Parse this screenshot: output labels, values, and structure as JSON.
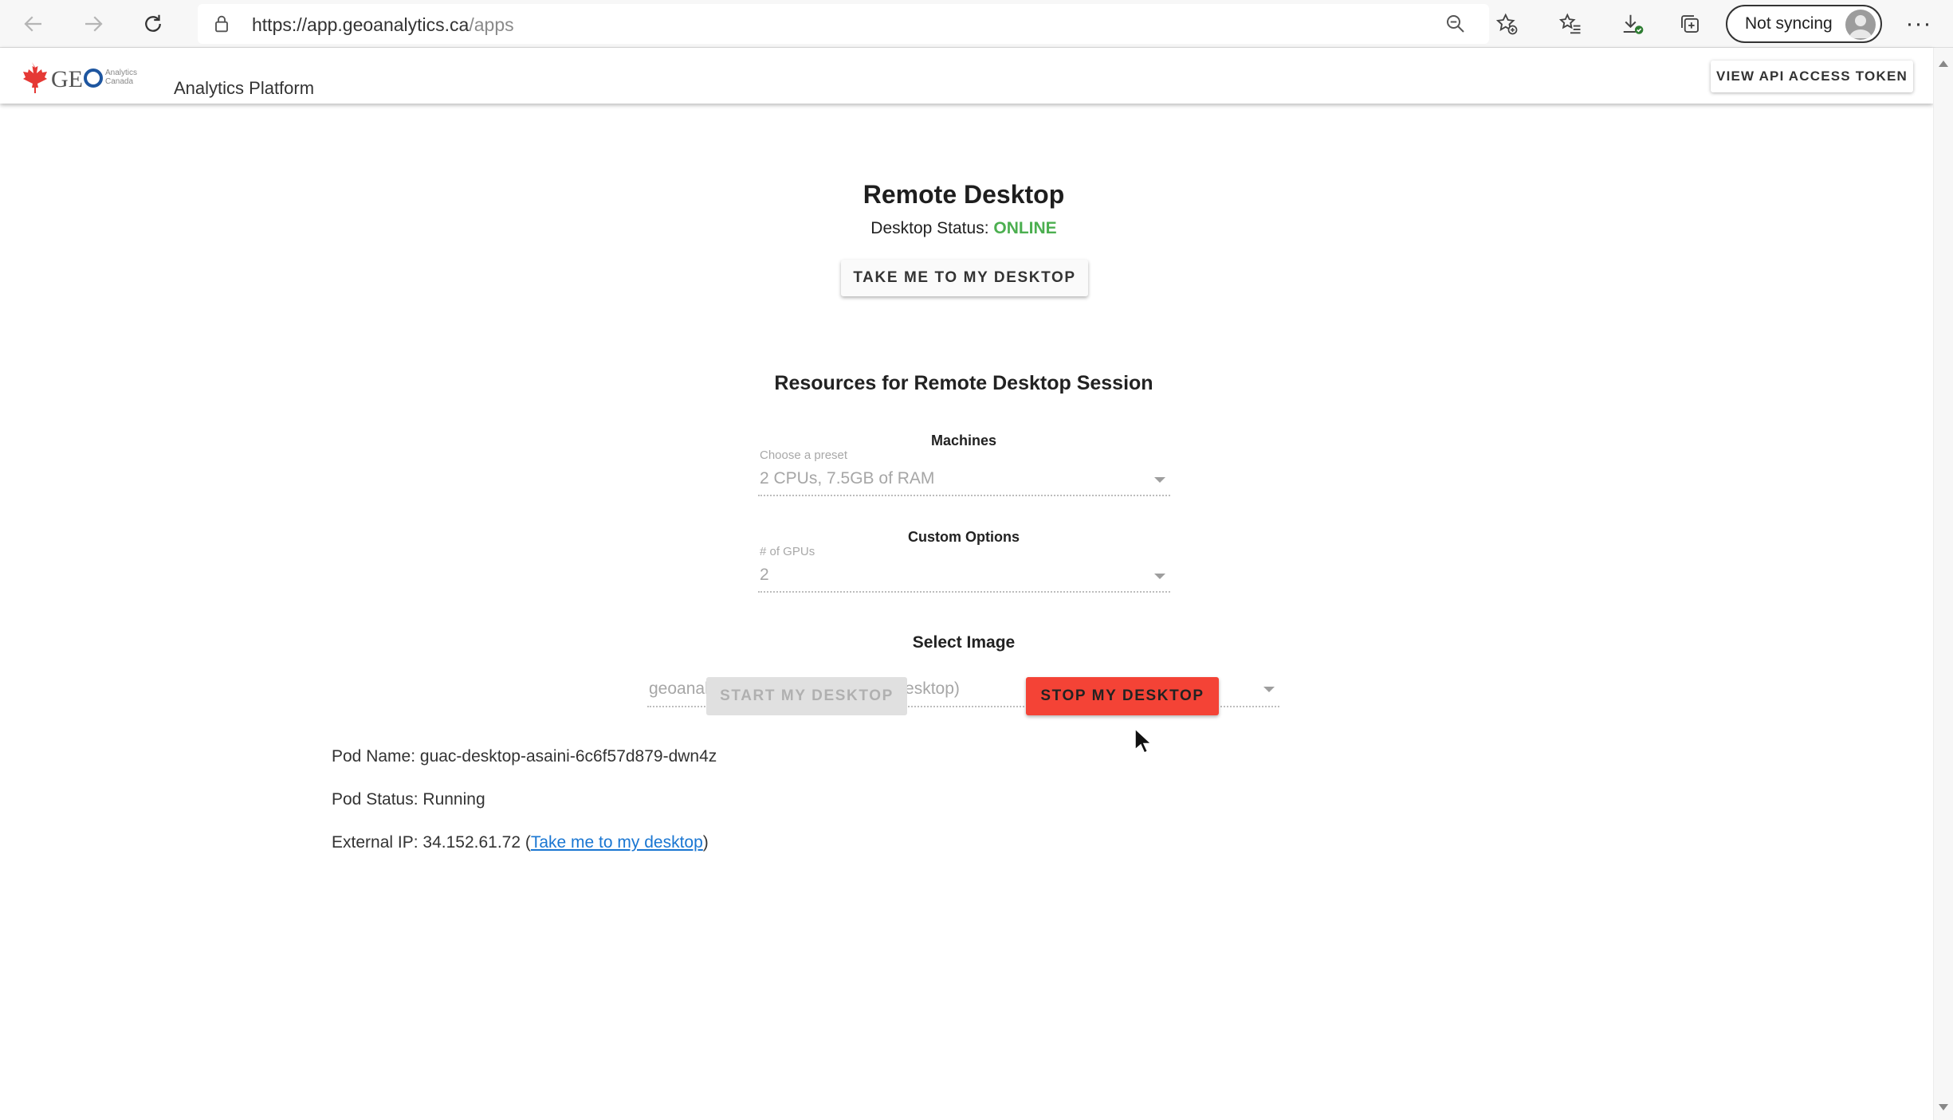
{
  "browser": {
    "url_host": "https://app.geoanalytics.ca",
    "url_path": "/apps",
    "sync_label": "Not syncing"
  },
  "header": {
    "logo_text": "GEO",
    "logo_sub": "Analytics Canada",
    "platform_title": "Analytics Platform",
    "token_button": "VIEW API ACCESS TOKEN"
  },
  "remote": {
    "title": "Remote Desktop",
    "status_label": "Desktop Status: ",
    "status_value": "ONLINE",
    "goto_button": "TAKE ME TO MY DESKTOP"
  },
  "resources": {
    "title": "Resources for Remote Desktop Session",
    "machines_title": "Machines",
    "preset_label": "Choose a preset",
    "preset_value": "2 CPUs, 7.5GB of RAM",
    "custom_title": "Custom Options",
    "gpu_label": "# of GPUs",
    "gpu_value": "2",
    "image_title": "Select Image",
    "image_value": "geoanalytics_base:asaini (saved desktop)"
  },
  "actions": {
    "start_button": "START MY DESKTOP",
    "stop_button": "STOP MY DESKTOP"
  },
  "pod": {
    "name_label": "Pod Name: ",
    "name_value": "guac-desktop-asaini-6c6f57d879-dwn4z",
    "status_label": "Pod Status: ",
    "status_value": "Running",
    "ip_label": "External IP: ",
    "ip_value": "34.152.61.72",
    "ip_open": " (",
    "ip_link": "Take me to my desktop",
    "ip_close": ")"
  },
  "colors": {
    "online": "#4caf50",
    "stop": "#f44336",
    "link": "#1976d2",
    "logo_red": "#e53935"
  }
}
